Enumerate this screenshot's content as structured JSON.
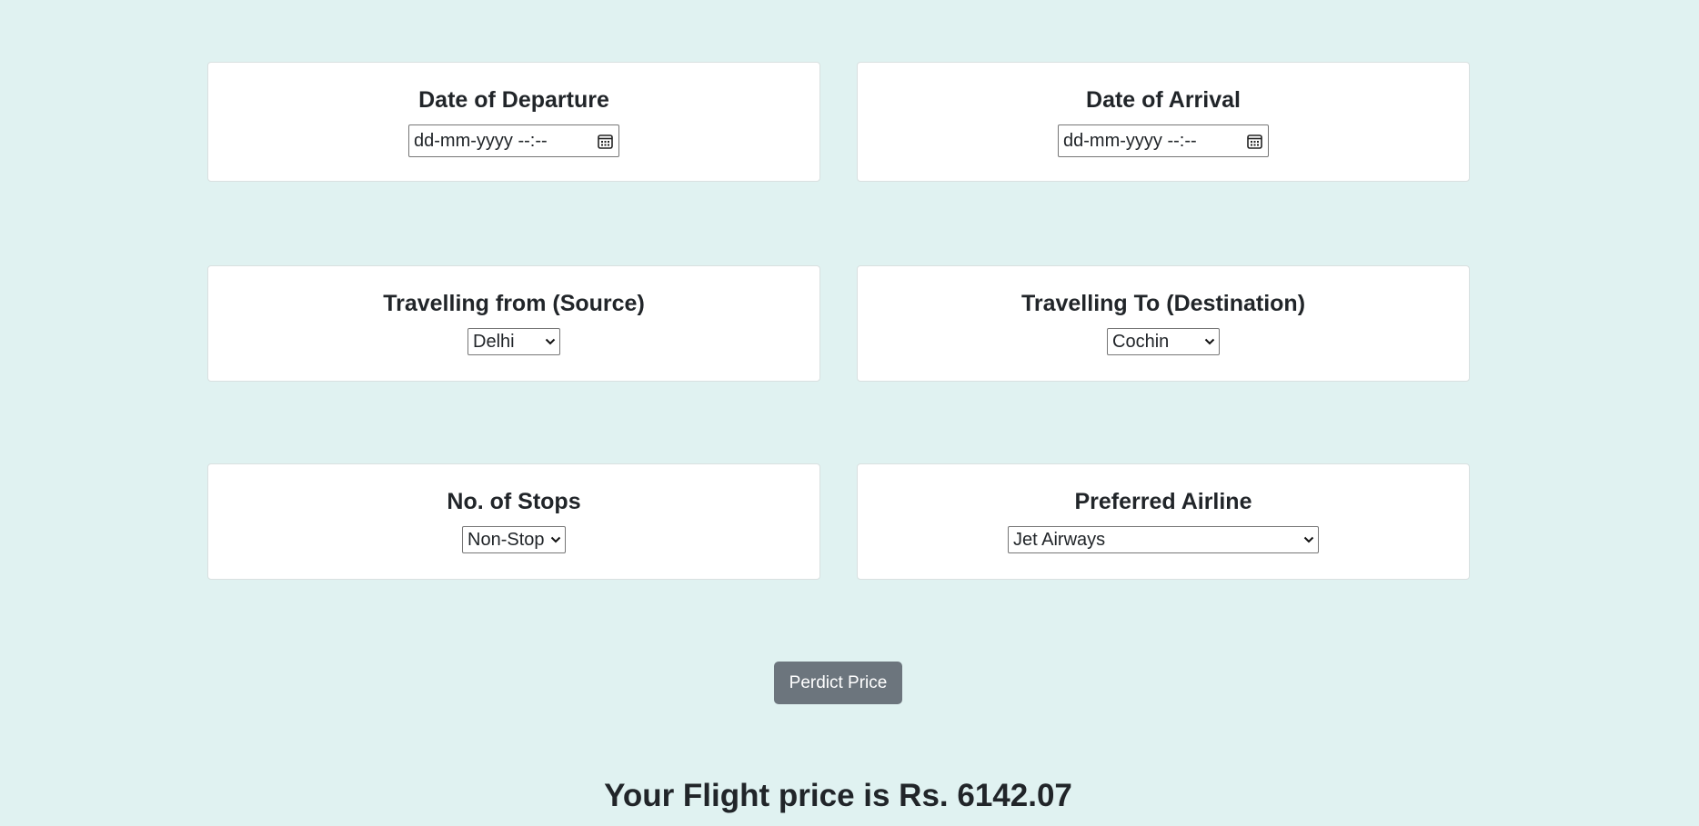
{
  "fields": {
    "departure": {
      "title": "Date of Departure",
      "placeholder": "dd-mm-yyyy --:--"
    },
    "arrival": {
      "title": "Date of Arrival",
      "placeholder": "dd-mm-yyyy --:--"
    },
    "source": {
      "title": "Travelling from (Source)",
      "selected": "Delhi"
    },
    "destination": {
      "title": "Travelling To (Destination)",
      "selected": "Cochin"
    },
    "stops": {
      "title": "No. of Stops",
      "selected": "Non-Stop"
    },
    "airline": {
      "title": "Preferred Airline",
      "selected": "Jet Airways"
    }
  },
  "predict_button": {
    "label": "Perdict Price"
  },
  "result": {
    "text": "Your Flight price is Rs. 6142.07"
  },
  "colors": {
    "background": "#e0f2f1",
    "card": "#ffffff",
    "button": "#6c757d",
    "text": "#212529"
  },
  "icons": {
    "date_picker": "calendar-icon",
    "select": "chevron-down-icon"
  }
}
